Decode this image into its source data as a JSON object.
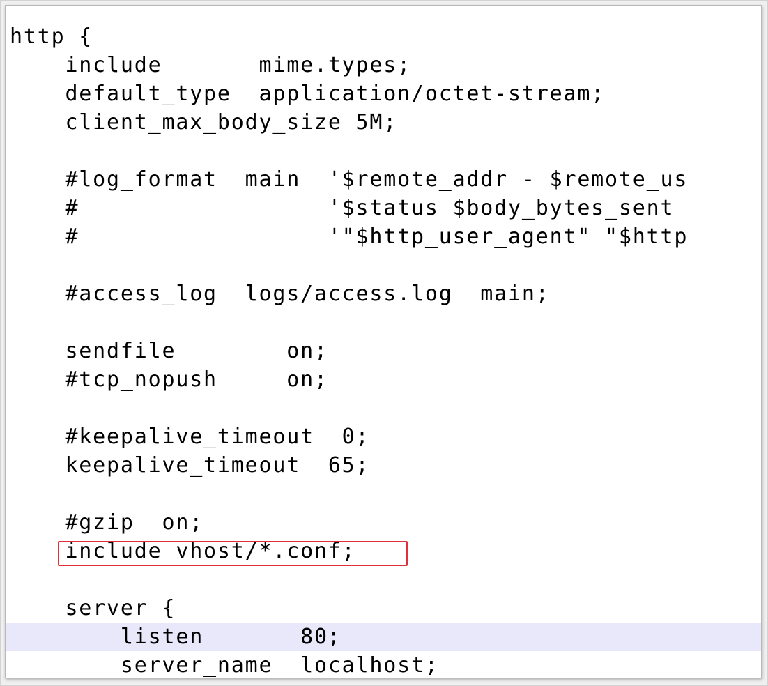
{
  "editor": {
    "lines": [
      "http {",
      "    include       mime.types;",
      "    default_type  application/octet-stream;",
      "    client_max_body_size 5M;",
      "",
      "    #log_format  main  '$remote_addr - $remote_us",
      "    #                  '$status $body_bytes_sent ",
      "    #                  '\"$http_user_agent\" \"$http",
      "",
      "    #access_log  logs/access.log  main;",
      "",
      "    sendfile        on;",
      "    #tcp_nopush     on;",
      "",
      "    #keepalive_timeout  0;",
      "    keepalive_timeout  65;",
      "",
      "    #gzip  on;",
      "    include vhost/*.conf;",
      "",
      "    server {",
      "        listen       80",
      "        server_name  localhost;"
    ],
    "current_line_suffix": ";",
    "highlight_color": "#e0303b",
    "current_line_color": "#e8e8fa"
  }
}
